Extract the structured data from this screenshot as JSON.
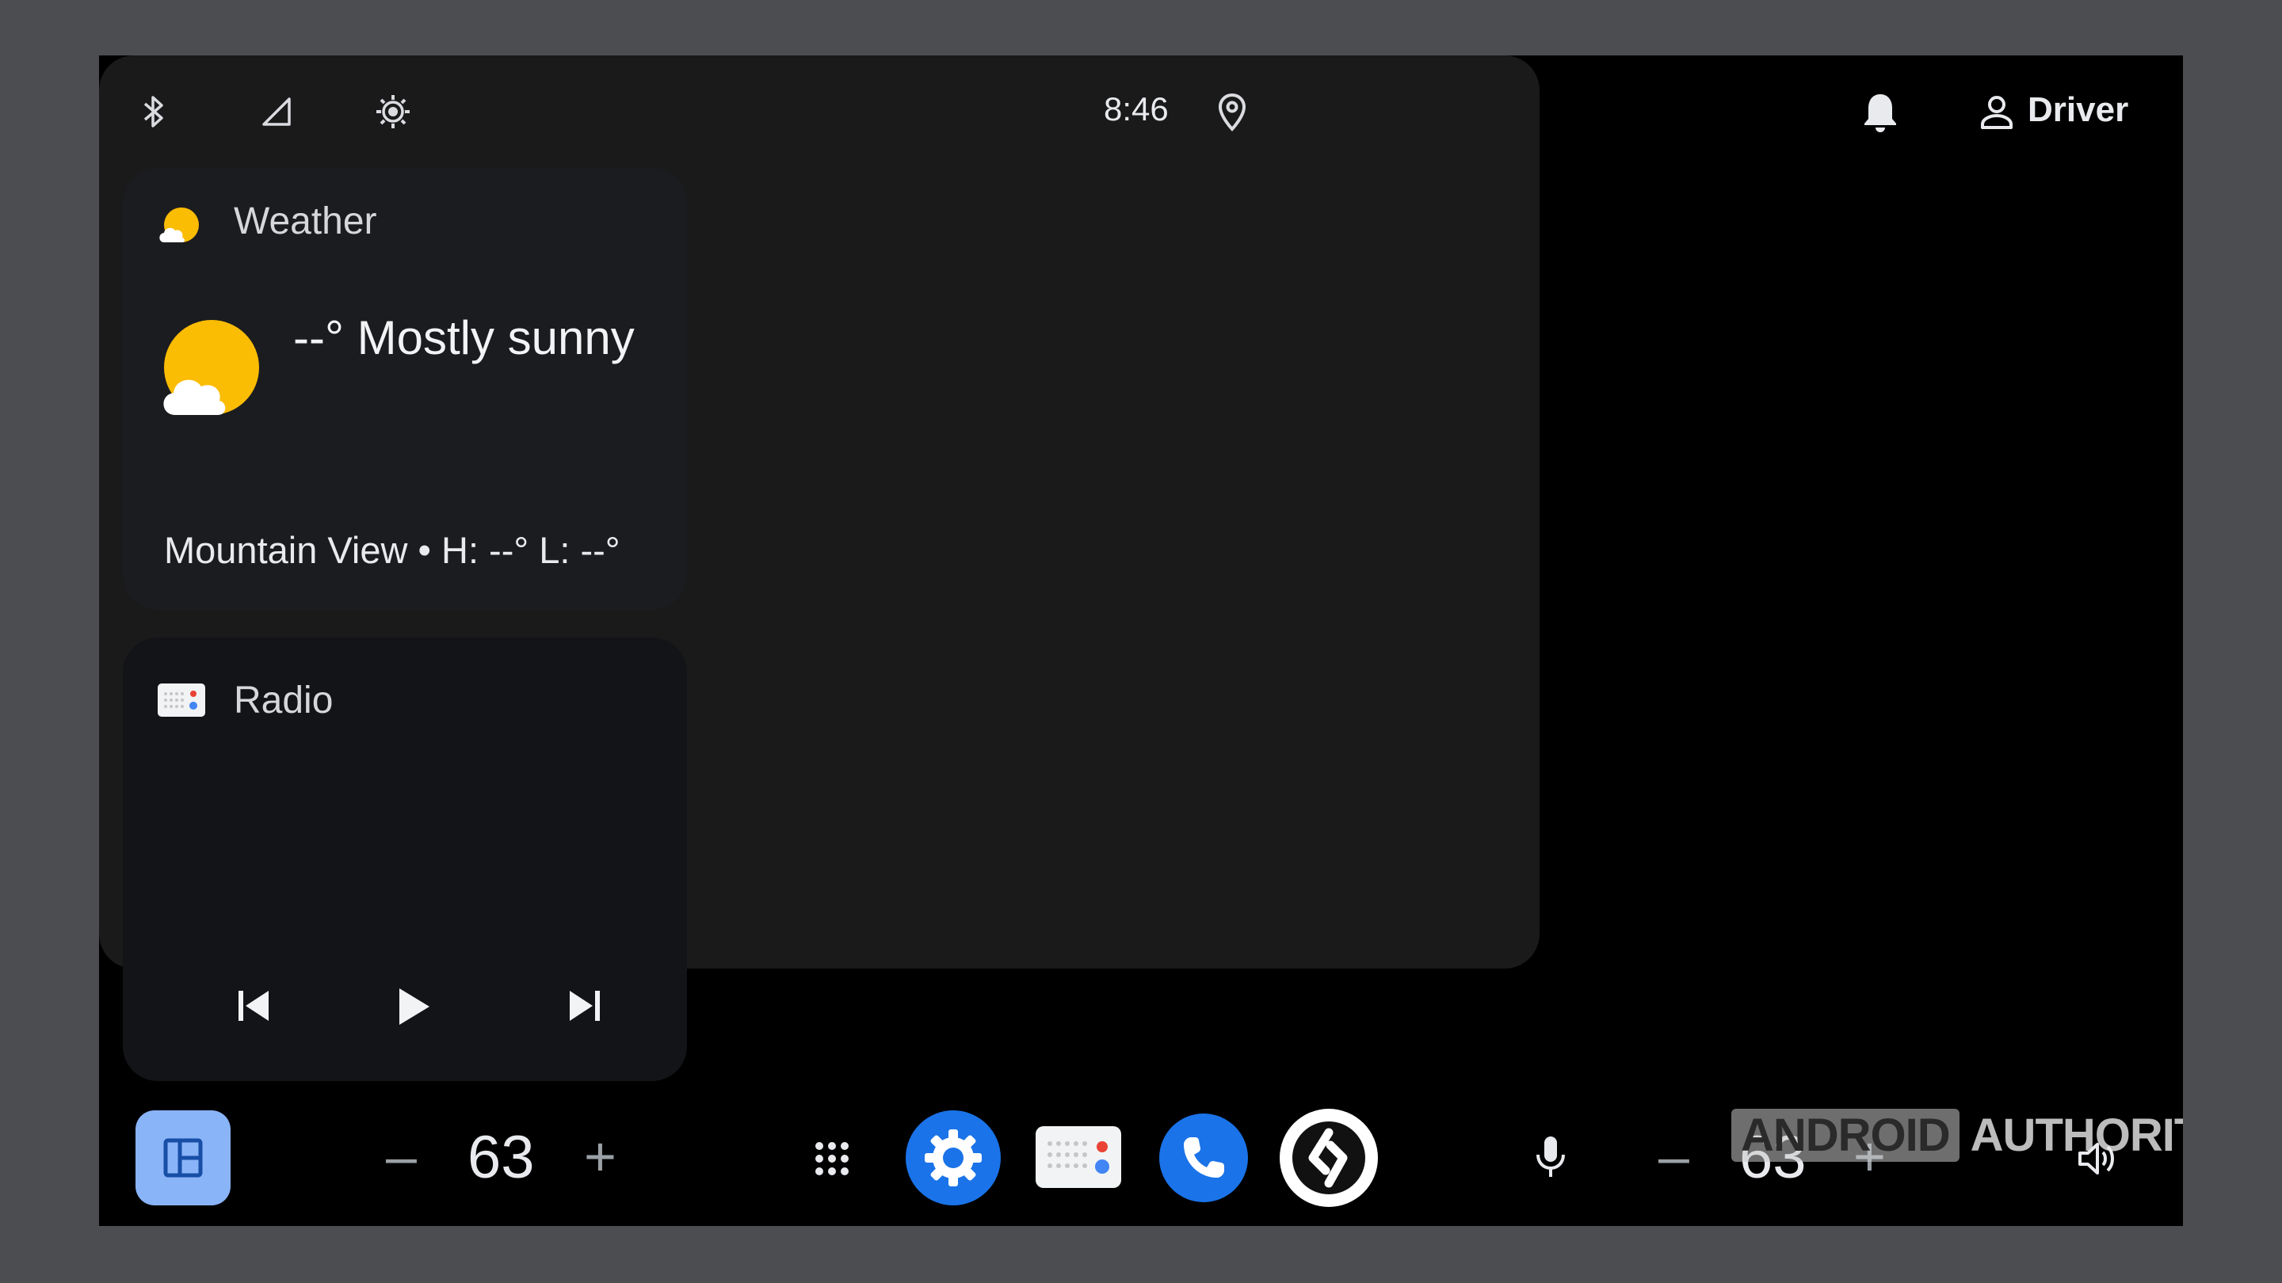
{
  "status_bar": {
    "time": "8:46",
    "user_label": "Driver",
    "icons": [
      "bluetooth-icon",
      "signal-icon",
      "brightness-icon",
      "location-icon",
      "notification-bell-icon",
      "person-icon"
    ]
  },
  "weather": {
    "title": "Weather",
    "condition": "--° Mostly sunny",
    "location_line": "Mountain View • H: --° L: --°",
    "icon": "partly-sunny-icon"
  },
  "radio": {
    "title": "Radio",
    "controls": [
      "skip-previous-icon",
      "play-icon",
      "skip-next-icon"
    ]
  },
  "bottom_bar": {
    "left_temp_minus": "–",
    "left_temp": "63",
    "left_temp_plus": "+",
    "right_temp_minus": "–",
    "right_temp": "63",
    "right_temp_plus": "+",
    "apps": [
      "app-grid-icon",
      "settings-app-icon",
      "radio-app-icon",
      "phone-app-icon",
      "assistant-app-icon",
      "microphone-icon"
    ]
  },
  "watermark": {
    "part1": "ANDROID",
    "part2": "AUTHORITY"
  },
  "colors": {
    "accent_blue": "#1a73e8",
    "home_button": "#8ab4f8",
    "sun_yellow": "#fbbc04",
    "screen_bg": "#000000"
  }
}
